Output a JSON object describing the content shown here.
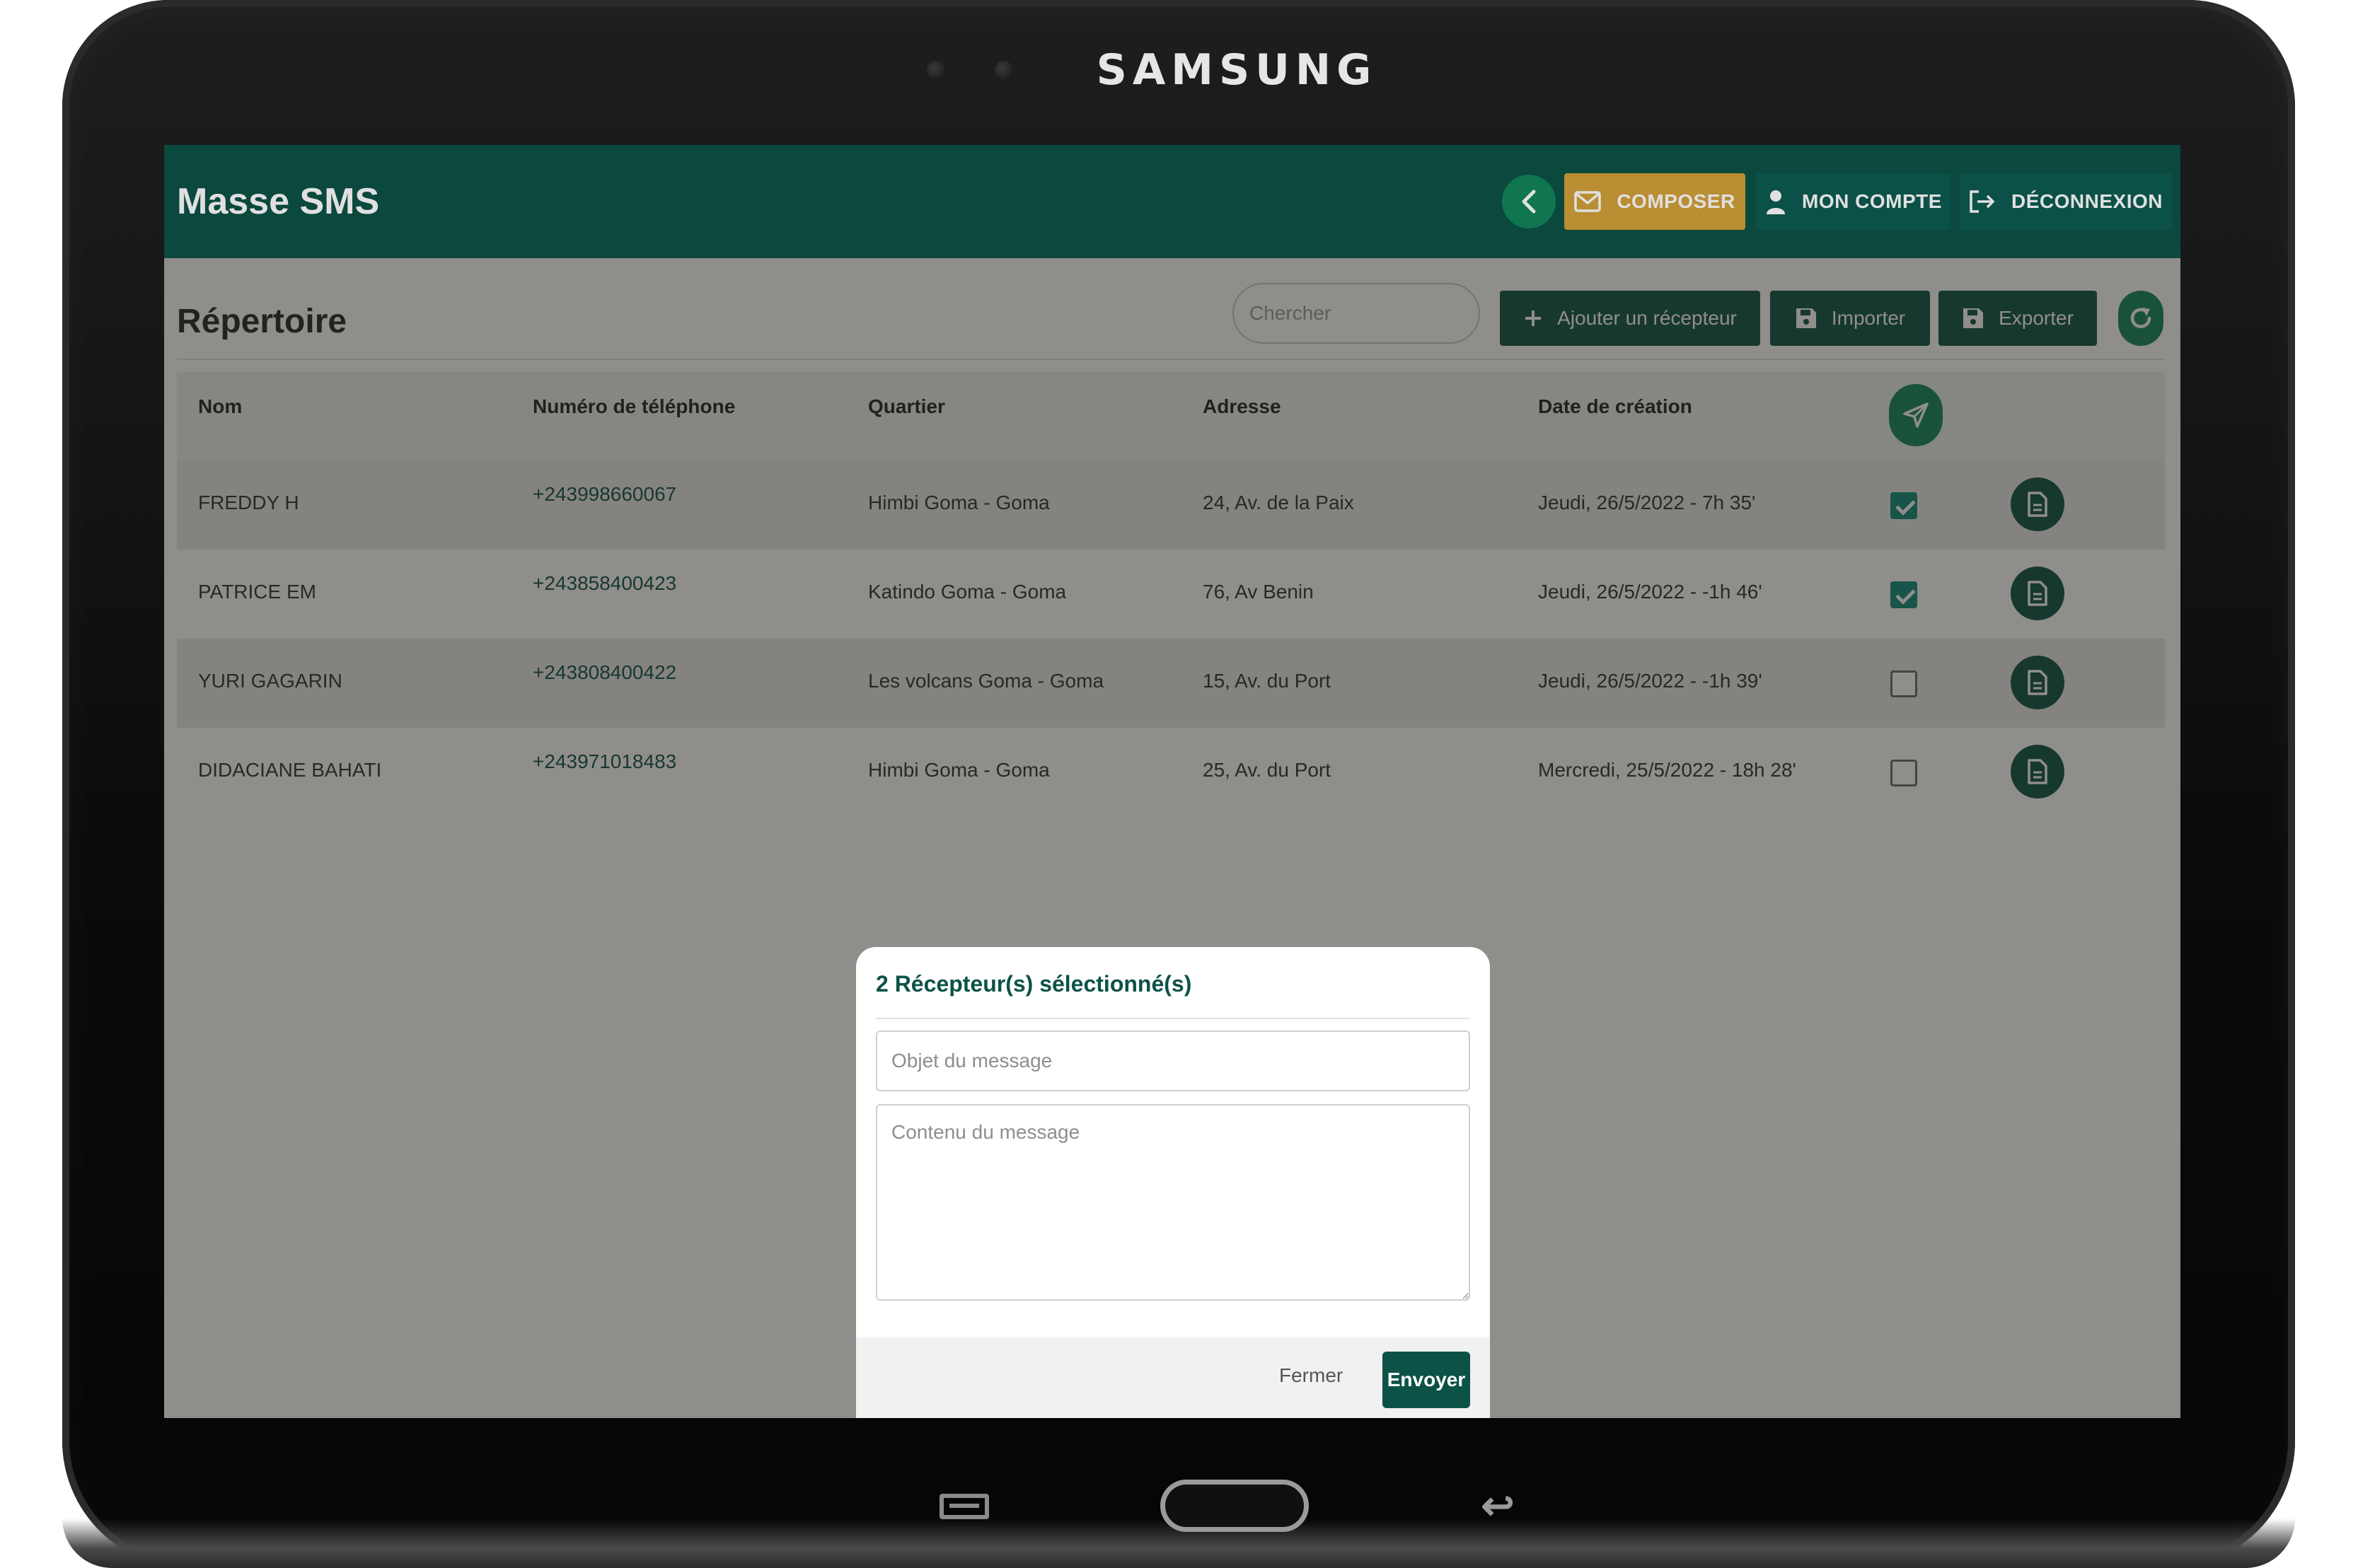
{
  "device": {
    "brand": "SAMSUNG"
  },
  "app": {
    "title": "Masse SMS"
  },
  "appbar": {
    "back_icon": "chevron-left-icon",
    "compose_label": "COMPOSER",
    "account_label": "MON COMPTE",
    "logout_label": "DÉCONNEXION"
  },
  "toolbar": {
    "title": "Répertoire",
    "search_placeholder": "Chercher",
    "add_label": "Ajouter un récepteur",
    "import_label": "Importer",
    "export_label": "Exporter"
  },
  "table": {
    "headers": [
      "Nom",
      "Numéro de téléphone",
      "Quartier",
      "Adresse",
      "Date de création"
    ],
    "rows": [
      {
        "name": "FREDDY H",
        "phone": "+243998660067",
        "district": "Himbi Goma - Goma",
        "address": "24, Av. de la Paix",
        "created": "Jeudi, 26/5/2022 - 7h 35'",
        "selected": true
      },
      {
        "name": "PATRICE EM",
        "phone": "+243858400423",
        "district": "Katindo Goma - Goma",
        "address": "76, Av Benin",
        "created": "Jeudi, 26/5/2022 - -1h 46'",
        "selected": true
      },
      {
        "name": "YURI GAGARIN",
        "phone": "+243808400422",
        "district": "Les volcans Goma - Goma",
        "address": "15, Av. du Port",
        "created": "Jeudi, 26/5/2022 - -1h 39'",
        "selected": false
      },
      {
        "name": "DIDACIANE BAHATI",
        "phone": "+243971018483",
        "district": "Himbi Goma - Goma",
        "address": "25, Av. du Port",
        "created": "Mercredi, 25/5/2022 - 18h 28'",
        "selected": false
      }
    ]
  },
  "modal": {
    "title": "2 Récepteur(s) sélectionné(s)",
    "subject_placeholder": "Objet du message",
    "content_placeholder": "Contenu du message",
    "close_label": "Fermer",
    "send_label": "Envoyer"
  },
  "colors": {
    "primary": "#0d5247",
    "accent_green": "#12875a",
    "compose_yellow": "#d4a23a",
    "checkbox_on": "#0e8a7d"
  }
}
